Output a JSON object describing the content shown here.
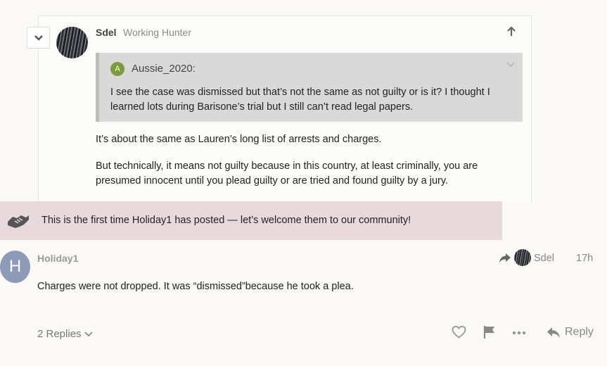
{
  "parent_post": {
    "author": "Sdel",
    "author_title": "Working Hunter",
    "quote": {
      "avatar_letter": "A",
      "username": "Aussie_2020:",
      "text": "I see the case was dismissed but that’s not the same as not guilty or is it? I thought I learned lots during Barisone’s trial but I still can’t read legal papers."
    },
    "paragraphs": [
      "It’s about the same as Lauren’s long list of arrests and charges.",
      "But technically, it means not guilty because in this country, at least criminally, you are presumed innocent until you plead guilty or are tried and found guilty by a jury."
    ]
  },
  "welcome_banner": {
    "text": "This is the first time Holiday1 has posted — let’s welcome them to our community!",
    "icon": "handshake-icon"
  },
  "reply_post": {
    "avatar_letter": "H",
    "author": "Holiday1",
    "reply_to": "Sdel",
    "time": "17h",
    "body": "Charges were not dropped. It was “dismissed”because he took a plea.",
    "replies_label": "2 Replies",
    "reply_label": "Reply"
  },
  "colors": {
    "banner_bg": "#e8d9dd",
    "quote_bg": "#d9d9d9",
    "avatar_h": "#8d9bb9",
    "avatar_a": "#7c9b3b"
  }
}
